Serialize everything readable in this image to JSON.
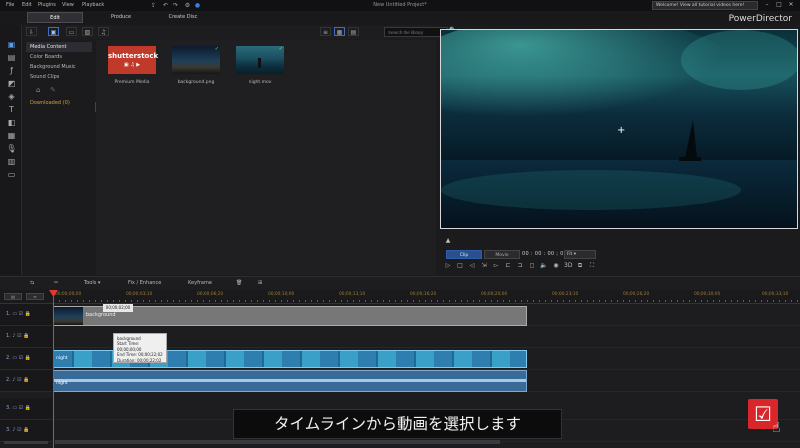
{
  "menu": {
    "items": [
      "File",
      "Edit",
      "Plugins",
      "View",
      "Playback"
    ],
    "title": "New Untitled Project*",
    "notice": "Welcome! View all tutorial videos here!"
  },
  "modes": {
    "edit": "Edit",
    "produce": "Produce",
    "create_disc": "Create Disc",
    "brand": "PowerDirector"
  },
  "media": {
    "search_placeholder": "Search the library",
    "categories": [
      "Media Content",
      "Color Boards",
      "Background Music",
      "Sound Clips"
    ],
    "downloaded": "Downloaded (0)",
    "thumbnails": [
      {
        "label": "Premium Media",
        "brand": "shutterstock"
      },
      {
        "label": "background.png"
      },
      {
        "label": "night.mov"
      }
    ]
  },
  "preview": {
    "clip_label": "Clip",
    "movie_label": "Movie",
    "timecode": "00 : 00 : 00 ; 00",
    "fit_label": "Fit"
  },
  "timeline_toolbar": {
    "tools_label": "Tools",
    "fix_label": "Fix / Enhance",
    "keyframe_label": "Keyframe"
  },
  "ruler": {
    "labels": [
      "00;00;00;00",
      "00;00;03;10",
      "00;00;06;20",
      "00;00;10;00",
      "00;00;13;10",
      "00;00;16;20",
      "00;00;20;00",
      "00;00;23;10",
      "00;00;26;20",
      "00;00;30;00",
      "00;00;33;10"
    ]
  },
  "tracks": {
    "numbers": [
      "1.",
      "1.",
      "2.",
      "2.",
      "3.",
      "3."
    ],
    "bg_clip_label": "background",
    "playhead_time": "00;00;02;00",
    "tooltip": [
      "background",
      "Start Time: 00;00;00;00",
      "End Time: 00;00;22;02",
      "Duration: 00;00;22;02"
    ],
    "video_clip_label": "night",
    "audio_clip_label": "night"
  },
  "subtitle": "タイムラインから動画を選択します",
  "colors": {
    "accent": "#2a4f8e",
    "playhead": "#e23a2e",
    "ruler": "#9d7f33",
    "video_clip": "#2e7fb0",
    "logo": "#d8262a"
  }
}
